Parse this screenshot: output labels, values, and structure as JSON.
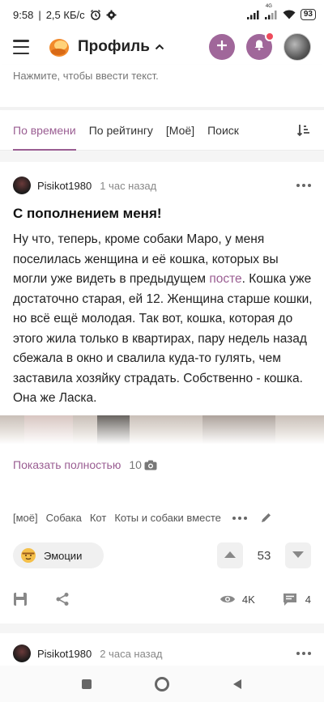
{
  "statusbar": {
    "time": "9:58",
    "speed": "2,5 КБ/с",
    "network": "4G",
    "battery": "93"
  },
  "header": {
    "title": "Профиль"
  },
  "hint": {
    "text": "Нажмите, чтобы ввести текст."
  },
  "tabs": [
    {
      "label": "По времени",
      "active": true
    },
    {
      "label": "По рейтингу",
      "active": false
    },
    {
      "label": "[Моё]",
      "active": false
    },
    {
      "label": "Поиск",
      "active": false
    }
  ],
  "post": {
    "author": "Pisikot1980",
    "time": "1 час назад",
    "title": "С пополнением меня!",
    "body_before": "Ну что, теперь, кроме собаки Маро, у меня поселилась женщина и её кошка, которых вы могли уже видеть в предыдущем ",
    "body_link": "посте",
    "body_after": ". Кошка уже достаточно старая, ей 12. Женщина старше кошки, но всё ещё молодая. Так вот, кошка, которая до этого жила только в квартирах, пару недель назад сбежала в окно и свалила куда-то гулять, чем заставила хозяйку страдать. Собственно - кошка. Она же Ласка.",
    "show_full": "Показать полностью",
    "image_count": "10",
    "tags": [
      "[моё]",
      "Собака",
      "Кот",
      "Коты и собаки вместе"
    ],
    "emotions_label": "Эмоции",
    "rating": "53",
    "views": "4K",
    "comments": "4"
  },
  "next_post": {
    "author": "Pisikot1980",
    "time": "2 часа назад"
  },
  "colors": {
    "accent": "#9a5d92",
    "button": "#a0679a",
    "notification": "#ee4b5c"
  }
}
